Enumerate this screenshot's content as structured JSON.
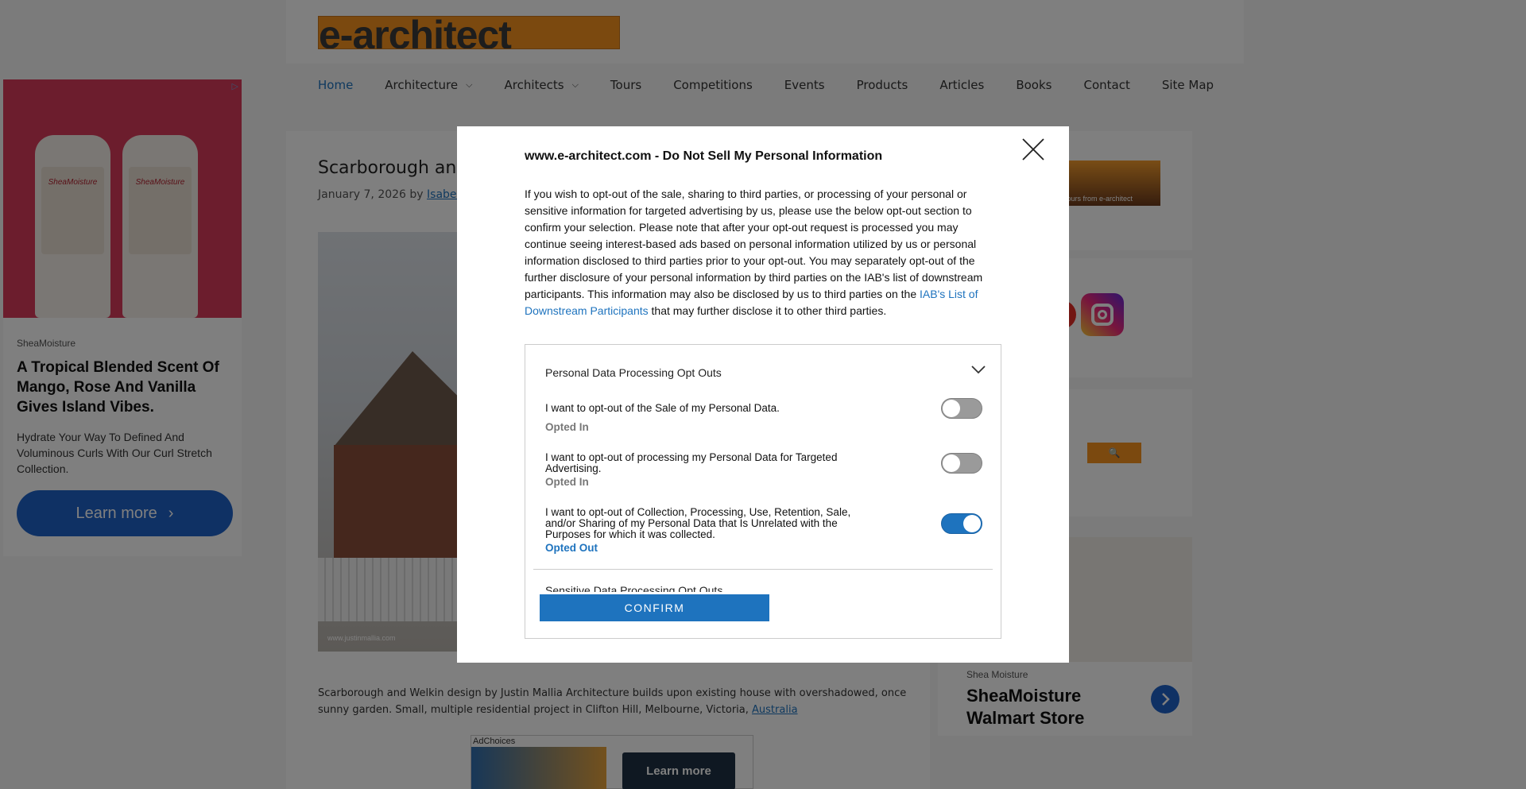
{
  "site": {
    "logo_text": "e-architect",
    "nav": [
      "Home",
      "Architecture",
      "Architects",
      "Tours",
      "Competitions",
      "Events",
      "Products",
      "Articles",
      "Books",
      "Contact",
      "Site Map"
    ],
    "nav_dropdowns": [
      "Architecture",
      "Architects"
    ],
    "active_nav": "Home"
  },
  "article": {
    "title": "Scarborough and",
    "date": "January 7, 2026",
    "by": "by",
    "author": "Isabelle",
    "image_credit": "www.justinmallia.com",
    "text": "Scarborough and Welkin design by Justin Mallia Architecture builds upon existing house with overshadowed, once sunny garden. Small, multiple residential project in Clifton Hill, Melbourne, Victoria,",
    "country_link": "Australia"
  },
  "left_ad": {
    "brand": "SheaMoisture",
    "headline": "A Tropical Blended Scent Of Mango, Rose And Vanilla Gives Island Vibes.",
    "body": "Hydrate Your Way To Defined And Voluminous Curls With Our Curl Stretch Collection.",
    "cta": "Learn more",
    "product_label": "SheaMoisture"
  },
  "right_ad": {
    "brand": "Shea Moisture",
    "title": "SheaMoisture Walmart Store"
  },
  "sidebar": {
    "tours_banner": "Tours from e-architect"
  },
  "bottom_ad": {
    "adchoices": "AdChoices",
    "cta": "Learn more"
  },
  "modal": {
    "title": "www.e-architect.com - Do Not Sell My Personal Information",
    "description_pre": "If you wish to opt-out of the sale, sharing to third parties, or processing of your personal or sensitive information for targeted advertising by us, please use the below opt-out section to confirm your selection. Please note that after your opt-out request is processed you may continue seeing interest-based ads based on personal information utilized by us or personal information disclosed to third parties prior to your opt-out. You may separately opt-out of the further disclosure of your personal information by third parties on the IAB's list of downstream participants. This information may also be disclosed by us to third parties on the ",
    "link_text": "IAB's List of Downstream Participants",
    "description_post": " that may further disclose it to other third parties.",
    "section1_title": "Personal Data Processing Opt Outs",
    "options": [
      {
        "label": "I want to opt-out of the Sale of my Personal Data.",
        "status": "Opted In",
        "on": false
      },
      {
        "label": "I want to opt-out of processing my Personal Data for Targeted Advertising.",
        "status": "Opted In",
        "on": false
      },
      {
        "label": "I want to opt-out of Collection, Processing, Use, Retention, Sale, and/or Sharing of my Personal Data that Is Unrelated with the Purposes for which it was collected.",
        "status": "Opted Out",
        "on": true
      }
    ],
    "section2_title": "Sensitive Data Processing Opt Outs",
    "confirm": "CONFIRM"
  },
  "colors": {
    "accent": "#1e73be",
    "logo_orange": "#f7931e",
    "ad_button": "#1f62c9",
    "toggle_off": "#9a9a9a"
  }
}
